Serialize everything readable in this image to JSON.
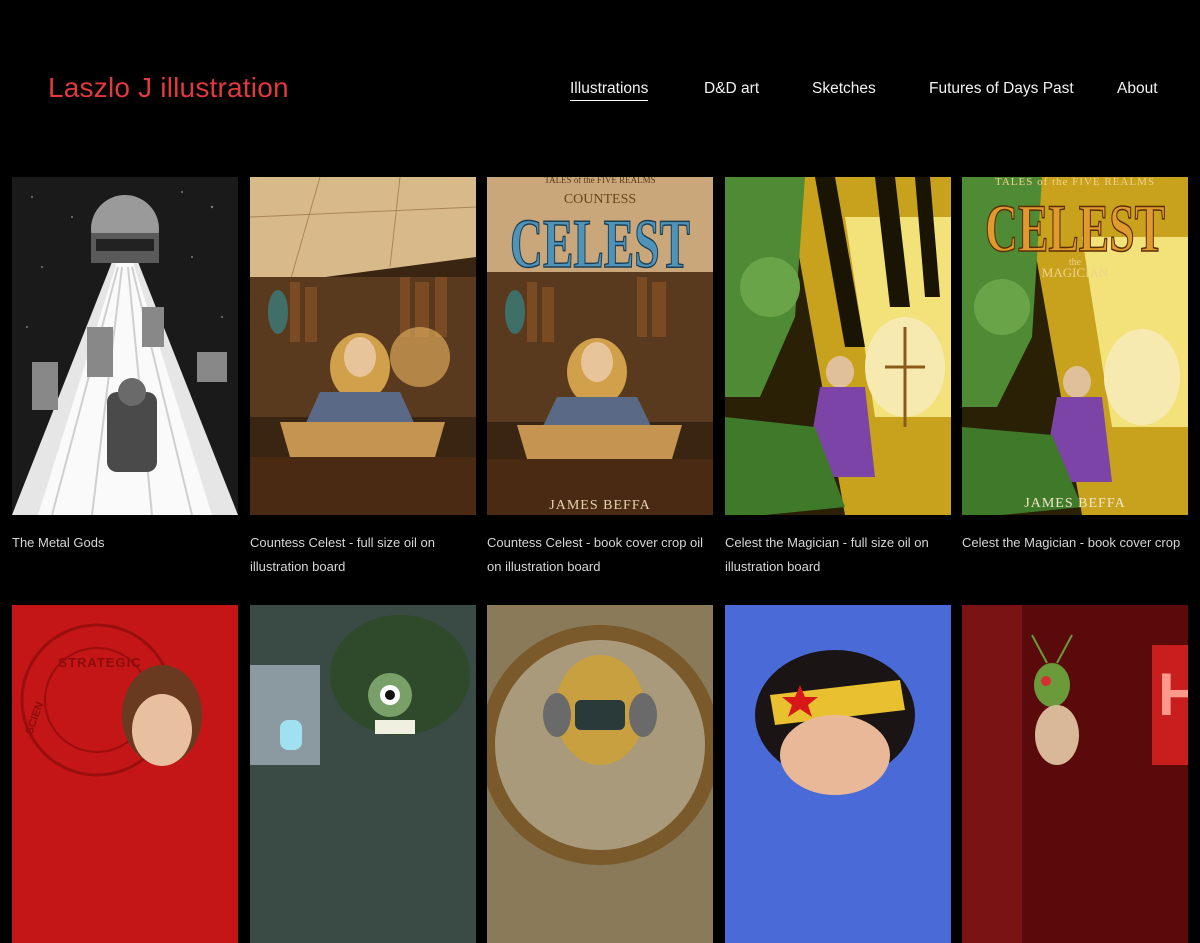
{
  "site": {
    "title": "Laszlo J illustration"
  },
  "nav": {
    "items": [
      {
        "label": "Illustrations",
        "active": true
      },
      {
        "label": "D&D art",
        "active": false
      },
      {
        "label": "Sketches",
        "active": false
      },
      {
        "label": "Futures of Days Past",
        "active": false
      },
      {
        "label": "About",
        "active": false
      }
    ]
  },
  "gallery": {
    "row1": [
      {
        "caption": "The Metal Gods"
      },
      {
        "caption": "Countess Celest - full size oil on illustration board"
      },
      {
        "caption": "Countess Celest - book cover crop oil on illustration board",
        "cover": {
          "series": "TALES of the FIVE REALMS",
          "subtitle": "COUNTESS",
          "title": "CELEST",
          "author": "JAMES BEFFA"
        }
      },
      {
        "caption": "Celest the Magician - full size oil on illustration board"
      },
      {
        "caption": "Celest the Magician - book cover crop",
        "cover": {
          "series": "TALES of the FIVE REALMS",
          "title": "CELEST",
          "the": "the",
          "subtitle": "MAGICIAN",
          "author": "JAMES BEFFA"
        }
      }
    ],
    "row2_badge_text": "STRATEGIC",
    "row2_badge_text2": "SCIEN",
    "row2_sign_letter": "HO"
  }
}
